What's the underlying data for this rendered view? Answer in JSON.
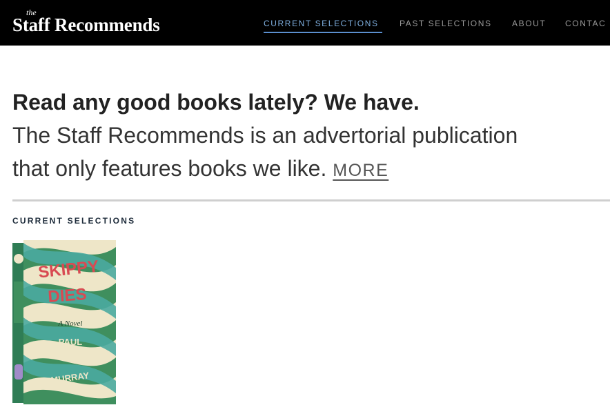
{
  "header": {
    "logo_prefix": "the",
    "logo_name": "Staff Recommends",
    "nav": [
      {
        "label": "CURRENT SELECTIONS",
        "active": true
      },
      {
        "label": "PAST SELECTIONS",
        "active": false
      },
      {
        "label": "ABOUT",
        "active": false
      },
      {
        "label": "CONTAC",
        "active": false
      }
    ]
  },
  "intro": {
    "headline": "Read any good books lately? We have.",
    "tagline": "The Staff Recommends is an advertorial publication that only features books we like.",
    "tagline_line1": "The Staff Recommends is an advertorial publication",
    "tagline_line2": "that only features books we like.",
    "more_label": "MORE"
  },
  "section": {
    "label": "CURRENT SELECTIONS"
  },
  "book": {
    "title_line1": "SKIPPY",
    "title_line2": "DIES",
    "subtitle": "A Novel",
    "author_first": "PAUL",
    "author_last": "MURRAY",
    "colors": {
      "cream": "#eee6c8",
      "green": "#3f8f5e",
      "teal": "#4aaaa0",
      "red": "#d84a52"
    }
  },
  "colors": {
    "topbar_bg": "#000000",
    "nav_active": "#7fb0e0",
    "nav_inactive": "#9a9a9a",
    "divider": "#cfcfcf"
  }
}
